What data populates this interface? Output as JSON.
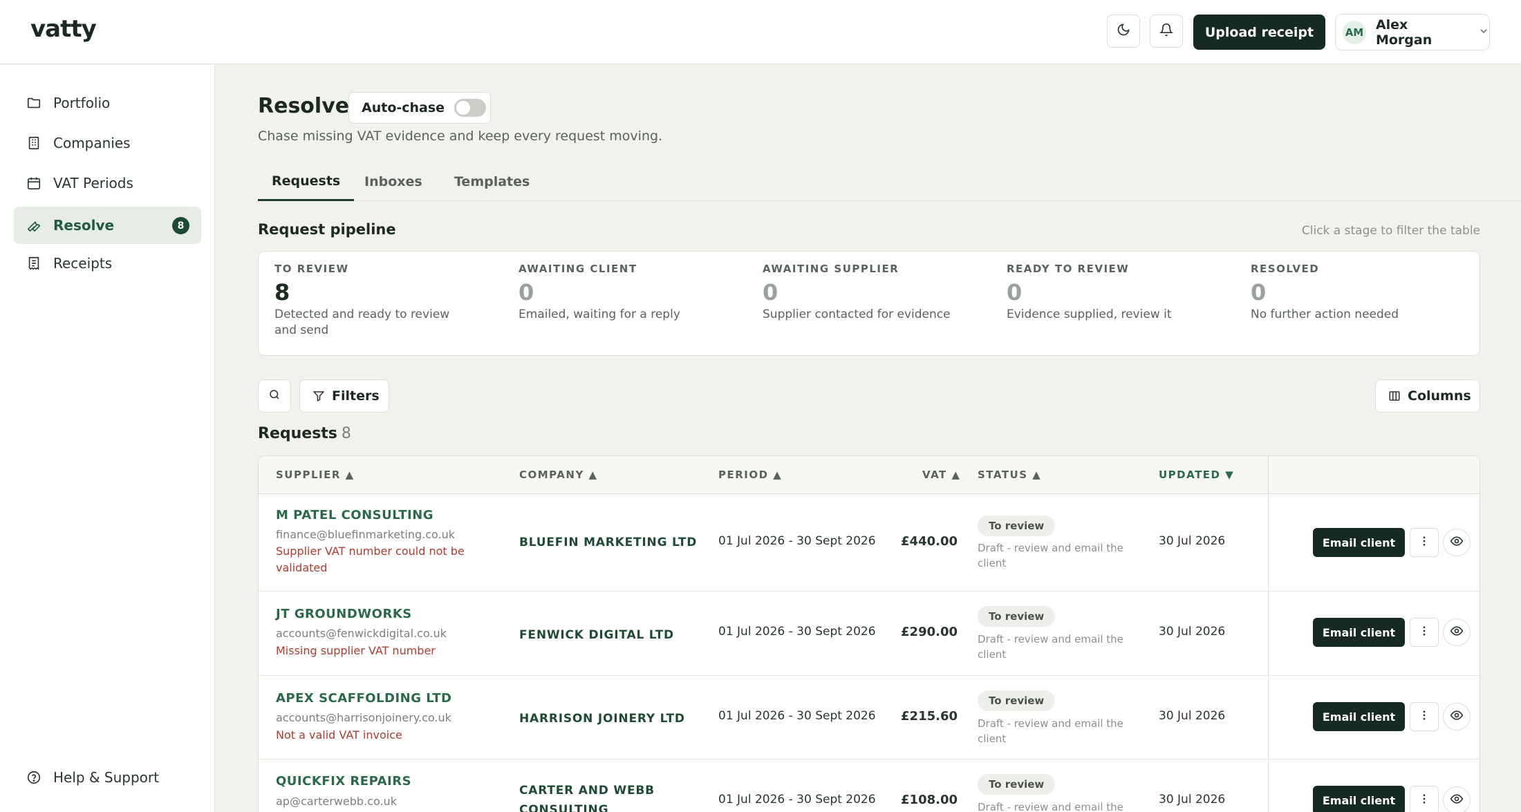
{
  "header": {
    "logo": "vatty",
    "upload_label": "Upload receipt",
    "user": {
      "initials": "AM",
      "name": "Alex Morgan"
    },
    "icons": [
      "moon-icon",
      "bell-icon",
      "chevron-down-icon"
    ]
  },
  "sidebar": {
    "items": [
      {
        "label": "Portfolio",
        "icon": "folder-icon"
      },
      {
        "label": "Companies",
        "icon": "building-icon"
      },
      {
        "label": "VAT Periods",
        "icon": "calendar-icon"
      },
      {
        "label": "Resolve",
        "icon": "wrench-icon",
        "badge": "8",
        "active": true
      },
      {
        "label": "Receipts",
        "icon": "receipt-icon"
      }
    ],
    "help_label": "Help & Support"
  },
  "page": {
    "title": "Resolve",
    "autochase_label": "Auto-chase",
    "autochase_on": false,
    "subtitle": "Chase missing VAT evidence and keep every request moving."
  },
  "tabs": [
    {
      "label": "Requests",
      "active": true
    },
    {
      "label": "Inboxes"
    },
    {
      "label": "Templates"
    }
  ],
  "pipeline": {
    "title": "Request pipeline",
    "hint": "Click a stage to filter the table",
    "stages": [
      {
        "label": "TO REVIEW",
        "count": "8",
        "desc": "Detected and ready to review and send"
      },
      {
        "label": "AWAITING CLIENT",
        "count": "0",
        "desc": "Emailed, waiting for a reply"
      },
      {
        "label": "AWAITING SUPPLIER",
        "count": "0",
        "desc": "Supplier contacted for evidence"
      },
      {
        "label": "READY TO REVIEW",
        "count": "0",
        "desc": "Evidence supplied, review it"
      },
      {
        "label": "RESOLVED",
        "count": "0",
        "desc": "No further action needed"
      }
    ]
  },
  "toolbar": {
    "filters_label": "Filters",
    "columns_label": "Columns"
  },
  "requests": {
    "title": "Requests",
    "count": "8",
    "columns": [
      "SUPPLIER ▲",
      "COMPANY ▲",
      "PERIOD ▲",
      "VAT ▲",
      "STATUS ▲",
      "UPDATED ▼"
    ],
    "email_label": "Email client",
    "rows": [
      {
        "supplier": "M PATEL CONSULTING",
        "email": "finance@bluefinmarketing.co.uk",
        "error": "Supplier VAT number could not be validated",
        "company": "BLUEFIN MARKETING LTD",
        "period": "01 Jul 2026 - 30 Sept 2026",
        "vat": "£440.00",
        "status": "To review",
        "status_desc": "Draft - review and email the client",
        "updated": "30 Jul 2026"
      },
      {
        "supplier": "JT GROUNDWORKS",
        "email": "accounts@fenwickdigital.co.uk",
        "error": "Missing supplier VAT number",
        "company": "FENWICK DIGITAL LTD",
        "period": "01 Jul 2026 - 30 Sept 2026",
        "vat": "£290.00",
        "status": "To review",
        "status_desc": "Draft - review and email the client",
        "updated": "30 Jul 2026"
      },
      {
        "supplier": "APEX SCAFFOLDING LTD",
        "email": "accounts@harrisonjoinery.co.uk",
        "error": "Not a valid VAT invoice",
        "company": "HARRISON JOINERY LTD",
        "period": "01 Jul 2026 - 30 Sept 2026",
        "vat": "£215.60",
        "status": "To review",
        "status_desc": "Draft - review and email the client",
        "updated": "30 Jul 2026"
      },
      {
        "supplier": "QUICKFIX REPAIRS",
        "email": "ap@carterwebb.co.uk",
        "error": "",
        "company": "CARTER AND WEBB CONSULTING",
        "period": "01 Jul 2026 - 30 Sept 2026",
        "vat": "£108.00",
        "status": "To review",
        "status_desc": "Draft - review and email the client",
        "updated": "30 Jul 2026"
      }
    ]
  }
}
